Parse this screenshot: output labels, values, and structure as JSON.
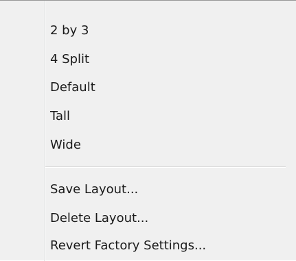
{
  "menu": {
    "layout_items": [
      {
        "label": "2 by 3"
      },
      {
        "label": "4 Split"
      },
      {
        "label": "Default"
      },
      {
        "label": "Tall"
      },
      {
        "label": "Wide"
      }
    ],
    "action_items": [
      {
        "label": "Save Layout..."
      },
      {
        "label": "Delete Layout..."
      },
      {
        "label": "Revert Factory Settings..."
      }
    ]
  }
}
